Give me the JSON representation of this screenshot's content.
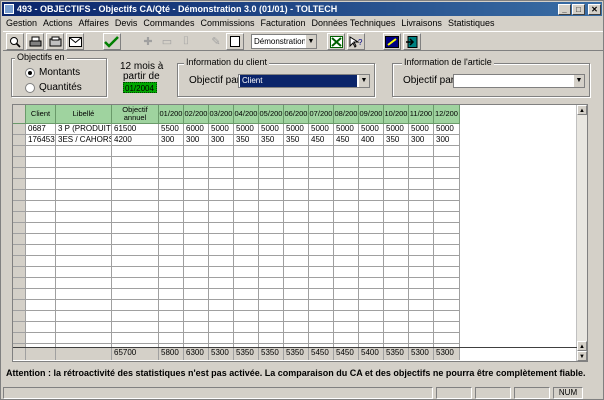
{
  "window": {
    "title": "493 - OBJECTIFS - Objectifs CA/Qté - Démonstration 3.0 (01/01) - TOLTECH",
    "controls": {
      "minimize": "_",
      "maximize": "□",
      "close": "✕"
    }
  },
  "menu": [
    "Gestion",
    "Actions",
    "Affaires",
    "Devis",
    "Commandes",
    "Commissions",
    "Facturation",
    "Données Techniques",
    "Livraisons",
    "Statistiques"
  ],
  "toolbar": {
    "database_combo": "Démonstration 3",
    "combo_arrow": "▼",
    "icons": [
      "preview-icon",
      "print-icon",
      "export-icon",
      "mail-icon",
      "validate-icon",
      "add-icon",
      "copy-icon",
      "delete-icon",
      "edit-icon",
      "new-icon",
      "excel-icon",
      "help-icon",
      "wizard-icon",
      "exit-icon"
    ]
  },
  "objectifs_en": {
    "legend": "Objectifs en",
    "options": [
      {
        "label": "Montants",
        "selected": true
      },
      {
        "label": "Quantités",
        "selected": false
      }
    ]
  },
  "period": {
    "line1": "12 mois à",
    "line2": "partir de",
    "date": "01/2004"
  },
  "client_info": {
    "legend": "Information du client",
    "label": "Objectif par",
    "value": "Client",
    "arrow": "▼"
  },
  "article_info": {
    "legend": "Information de l'article",
    "label": "Objectif par",
    "value": "",
    "arrow": "▼"
  },
  "grid": {
    "headers": [
      "Client",
      "Libellé",
      "Objectif annuel",
      "01/200",
      "02/200",
      "03/200",
      "04/200",
      "05/200",
      "06/200",
      "07/200",
      "08/200",
      "09/200",
      "10/200",
      "11/200",
      "12/200"
    ],
    "rows": [
      [
        "0687",
        "3 P (PRODUITS PI",
        "61500",
        "5500",
        "6000",
        "5000",
        "5000",
        "5000",
        "5000",
        "5000",
        "5000",
        "5000",
        "5000",
        "5000",
        "5000"
      ],
      [
        "176453",
        "3ES / CAHORS",
        "4200",
        "300",
        "300",
        "300",
        "350",
        "350",
        "350",
        "450",
        "450",
        "400",
        "350",
        "300",
        "300"
      ]
    ],
    "totals": [
      "",
      "",
      "65700",
      "5800",
      "6300",
      "5300",
      "5350",
      "5350",
      "5350",
      "5450",
      "5450",
      "5400",
      "5350",
      "5300",
      "5300"
    ],
    "scroll_up": "▲",
    "scroll_down": "▼"
  },
  "warning": "Attention : la rétroactivité des statistiques n'est pas activée. La comparaison du CA et des objectifs ne pourra être complètement fiable.",
  "status": {
    "num": "NUM"
  }
}
